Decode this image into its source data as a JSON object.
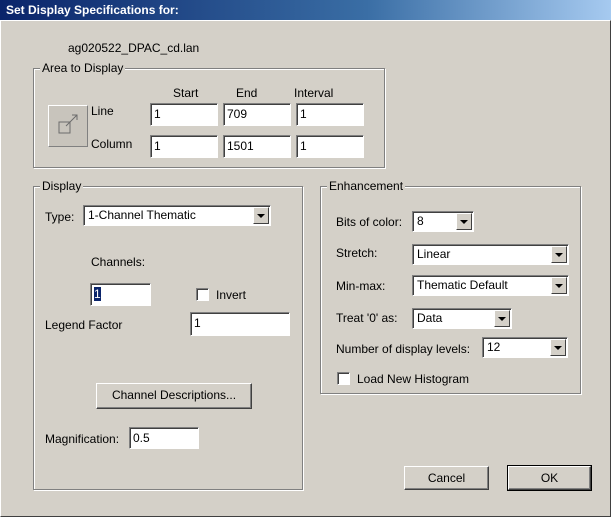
{
  "window": {
    "title": "Set Display Specifications for:"
  },
  "file_name": "ag020522_DPAC_cd.lan",
  "area": {
    "legend": "Area to Display",
    "headers": {
      "start": "Start",
      "end": "End",
      "interval": "Interval"
    },
    "line": {
      "label": "Line",
      "start": "1",
      "end": "709",
      "interval": "1"
    },
    "column": {
      "label": "Column",
      "start": "1",
      "end": "1501",
      "interval": "1"
    }
  },
  "display": {
    "legend": "Display",
    "type_label": "Type:",
    "type_value": "1-Channel Thematic",
    "channels_label": "Channels:",
    "channel_value": "1",
    "invert_label": "Invert",
    "legend_factor_label": "Legend Factor",
    "legend_factor_value": "1",
    "channel_desc_button": "Channel Descriptions...",
    "magnification_label": "Magnification:",
    "magnification_value": "0.5"
  },
  "enhancement": {
    "legend": "Enhancement",
    "bits_label": "Bits of color:",
    "bits_value": "8",
    "stretch_label": "Stretch:",
    "stretch_value": "Linear",
    "minmax_label": "Min-max:",
    "minmax_value": "Thematic Default",
    "treat0_label": "Treat '0' as:",
    "treat0_value": "Data",
    "levels_label": "Number of display levels:",
    "levels_value": "12",
    "load_hist_label": "Load New Histogram"
  },
  "buttons": {
    "cancel": "Cancel",
    "ok": "OK"
  }
}
